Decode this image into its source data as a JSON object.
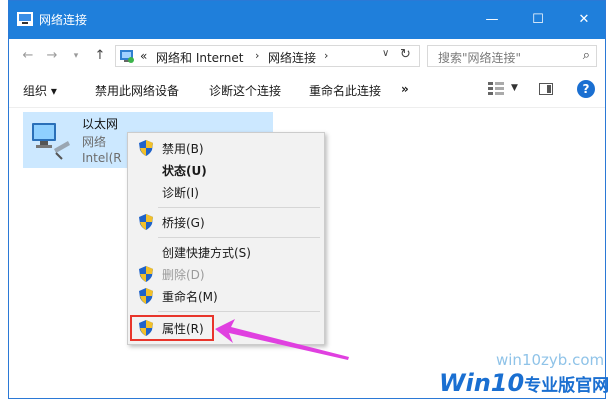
{
  "window": {
    "title": "网络连接"
  },
  "window_controls": {
    "minimize": "—",
    "maximize": "☐",
    "close": "✕"
  },
  "address": {
    "prefix": "«",
    "path": [
      "网络和 Internet",
      "网络连接"
    ],
    "separator": "›",
    "search_placeholder": "搜索\"网络连接\""
  },
  "toolbar": {
    "organize": "组织 ▾",
    "disable": "禁用此网络设备",
    "diagnose": "诊断这个连接",
    "rename": "重命名此连接",
    "more": "»"
  },
  "connection": {
    "name": "以太网",
    "status": "网络",
    "device": "Intel(R"
  },
  "context_menu": {
    "items": [
      {
        "label": "禁用(B)",
        "shield": true
      },
      {
        "label": "状态(U)",
        "bold": true
      },
      {
        "label": "诊断(I)"
      },
      {
        "label": "桥接(G)",
        "shield": true
      },
      {
        "label": "创建快捷方式(S)"
      },
      {
        "label": "删除(D)",
        "shield": true,
        "disabled": true
      },
      {
        "label": "重命名(M)",
        "shield": true
      },
      {
        "label": "属性(R)",
        "shield": true,
        "highlighted": true
      }
    ]
  },
  "watermark": {
    "site": "win10zyb.com",
    "brand": "Win10",
    "brand_cn": "专业版官网"
  },
  "colors": {
    "accent": "#1f7fdb",
    "selection": "#cce8ff",
    "highlight_box": "#e8352b",
    "arrow": "#e040e0"
  }
}
